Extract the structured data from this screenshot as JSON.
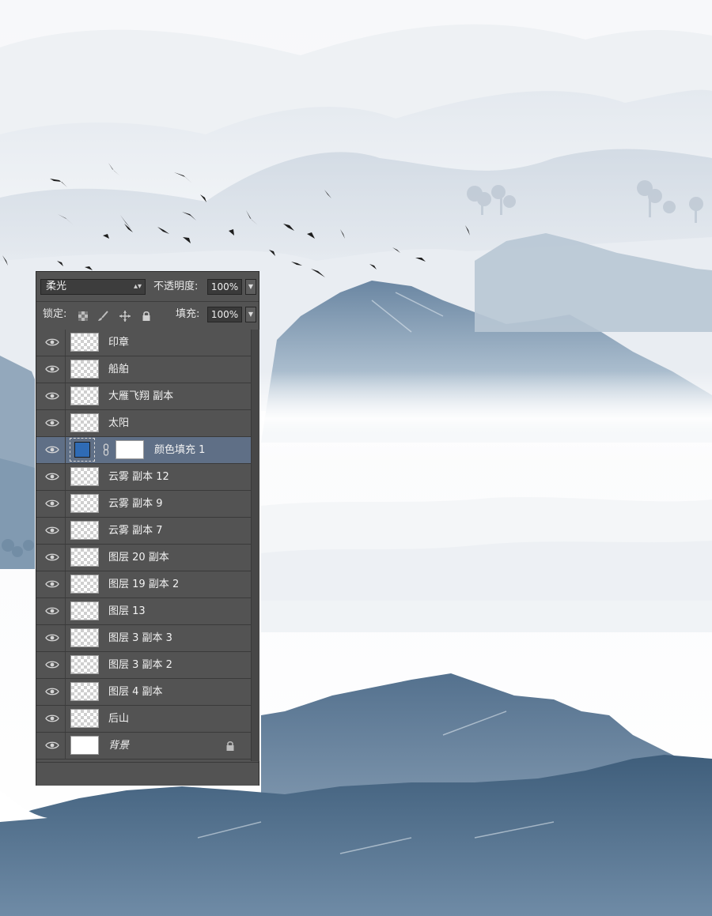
{
  "toolbar": {
    "blend_mode": "柔光",
    "opacity_label": "不透明度:",
    "opacity_value": "100%",
    "lock_label": "锁定:",
    "fill_label": "填充:",
    "fill_value": "100%"
  },
  "layers": [
    {
      "name": "印章",
      "thumb": "transparent"
    },
    {
      "name": "船舶",
      "thumb": "transparent"
    },
    {
      "name": "大雁飞翔 副本",
      "thumb": "transparent"
    },
    {
      "name": "太阳",
      "thumb": "transparent"
    },
    {
      "name": "颜色填充 1",
      "thumb": "fill",
      "selected": true,
      "fill_color": "#2f6bb5"
    },
    {
      "name": "云雾 副本 12",
      "thumb": "transparent"
    },
    {
      "name": "云雾 副本 9",
      "thumb": "transparent"
    },
    {
      "name": "云雾 副本 7",
      "thumb": "transparent"
    },
    {
      "name": "图层 20 副本",
      "thumb": "transparent"
    },
    {
      "name": "图层 19 副本 2",
      "thumb": "transparent"
    },
    {
      "name": "图层 13",
      "thumb": "transparent"
    },
    {
      "name": "图层 3 副本 3",
      "thumb": "transparent"
    },
    {
      "name": "图层 3 副本 2",
      "thumb": "transparent"
    },
    {
      "name": "图层 4 副本",
      "thumb": "transparent"
    },
    {
      "name": "后山",
      "thumb": "transparent"
    },
    {
      "name": "背景",
      "thumb": "white",
      "locked": true,
      "italic": true
    }
  ],
  "icons": {
    "eye": "eye-icon",
    "lock": "lock-icon",
    "chain": "link-icon",
    "brush": "brush-icon",
    "move": "move-icon",
    "checker": "transparency-lock-icon"
  },
  "colors": {
    "panel_bg": "#535353",
    "selected_row": "#5f6f86",
    "fill_swatch": "#2f6bb5",
    "mountain_dark": "#4c6a86"
  }
}
